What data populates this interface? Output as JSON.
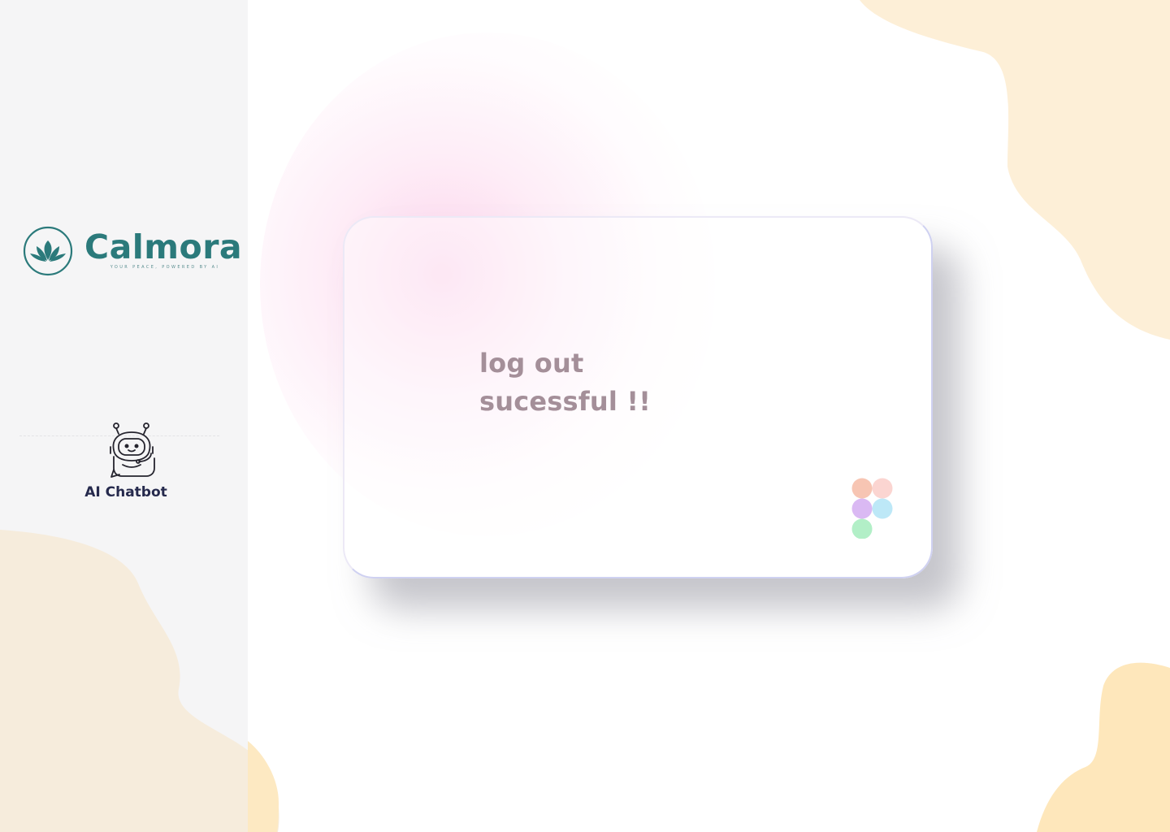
{
  "brand": {
    "name": "Calmora",
    "tagline": "YOUR PEACE, POWERED BY AI",
    "logo_icon": "lotus-icon",
    "color": "#2b7a7b"
  },
  "sidebar": {
    "nav_item": {
      "label": "AI Chatbot",
      "icon": "chatbot-icon"
    },
    "background": "#f5f5f6"
  },
  "card": {
    "message_line1": "log out",
    "message_line2": "sucessful !!",
    "message_color": "#a48f99",
    "corner_icon": "figma-icon"
  },
  "colors": {
    "blob": "#fdefd7",
    "glow": "#fbcde8"
  }
}
